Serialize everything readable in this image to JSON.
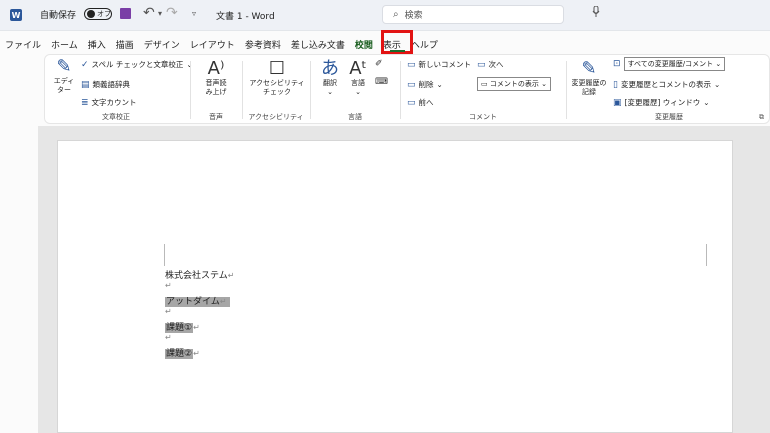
{
  "titlebar": {
    "logo": "W",
    "autosave_label": "自動保存",
    "autosave_state": "オフ",
    "undo_icon": "↶",
    "redo_icon": "↷",
    "doc_title": "文書 1  -  Word",
    "search_placeholder": "検索",
    "search_icon": "⌕",
    "mic_icon": "🎙"
  },
  "tabs": [
    "ファイル",
    "ホーム",
    "挿入",
    "描画",
    "デザイン",
    "レイアウト",
    "参考資料",
    "差し込み文書",
    "校閲",
    "表示",
    "ヘルプ"
  ],
  "active_tab_index": 8,
  "ribbon": {
    "proofing": {
      "editor_label": "エディ\nター",
      "spell_label": "スペル チェックと文章校正",
      "thesaurus_label": "類義語辞典",
      "wordcount_label": "文字カウント",
      "group_label": "文章校正"
    },
    "speech": {
      "read_aloud_label": "音声読\nみ上げ",
      "group_label": "音声"
    },
    "accessibility": {
      "check_label": "アクセシビリティ\nチェック",
      "group_label": "アクセシビリティ"
    },
    "language": {
      "translate_label": "翻訳",
      "language_label": "言語",
      "group_label": "言語"
    },
    "comments": {
      "new_comment": "新しいコメント",
      "next": "次へ",
      "delete": "削除",
      "previous": "前へ",
      "show_comments": "コメントの表示",
      "group_label": "コメント"
    },
    "tracking": {
      "track_changes_label": "変更履歴の\n記録",
      "markup_dropdown": "すべての変更履歴/コメント",
      "show_markup": "変更履歴とコメントの表示",
      "review_pane": "[変更履歴] ウィンドウ",
      "group_label": "変更履歴"
    }
  },
  "document": {
    "lines": [
      {
        "text": "株式会社ステム",
        "selected": false
      },
      {
        "text": "",
        "selected": false
      },
      {
        "text": "アットダイム",
        "selected": true
      },
      {
        "text": "",
        "selected": false
      },
      {
        "text": "課題①",
        "selected": true
      },
      {
        "text": "",
        "selected": false
      },
      {
        "text": "課題②",
        "selected": true
      }
    ],
    "paragraph_mark": "↵"
  }
}
